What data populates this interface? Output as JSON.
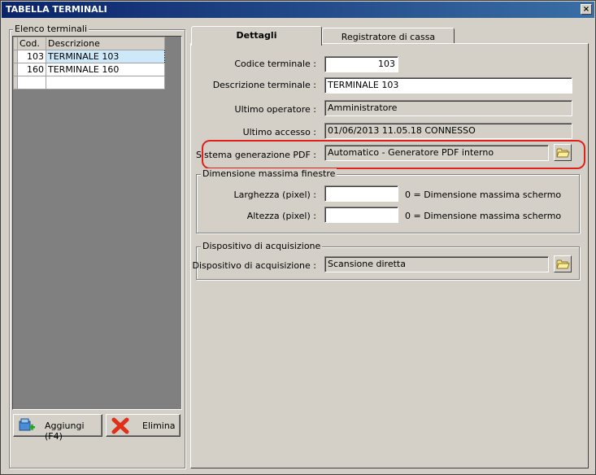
{
  "window": {
    "title": "TABELLA TERMINALI",
    "close_label": "×"
  },
  "left": {
    "group_title": "Elenco terminali",
    "columns": {
      "cod": "Cod.",
      "desc": "Descrizione"
    },
    "rows": [
      {
        "cod": "103",
        "desc": "TERMINALE 103"
      },
      {
        "cod": "160",
        "desc": "TERMINALE 160"
      }
    ],
    "add_button": "Aggiungi (F4)",
    "delete_button": "Elimina"
  },
  "tabs": [
    "Dettagli",
    "Registratore di cassa"
  ],
  "details": {
    "codice_label": "Codice terminale :",
    "codice_value": "103",
    "descrizione_label": "Descrizione terminale :",
    "descrizione_value": "TERMINALE 103",
    "operatore_label": "Ultimo operatore :",
    "operatore_value": "Amministratore",
    "accesso_label": "Ultimo accesso :",
    "accesso_value": "01/06/2013  11.05.18  CONNESSO",
    "pdf_label": "Sistema generazione PDF :",
    "pdf_value": "Automatico - Generatore PDF interno"
  },
  "dimensioni": {
    "group_title": "Dimensione massima finestre",
    "larghezza_label": "Larghezza (pixel) :",
    "larghezza_value": "",
    "altezza_label": "Altezza (pixel) :",
    "altezza_value": "",
    "note": "0 = Dimensione massima schermo"
  },
  "acquisizione": {
    "group_title": "Dispositivo di acquisizione",
    "label": "Dispositivo di acquisizione :",
    "value": "Scansione diretta"
  },
  "colors": {
    "highlight": "#e0201a",
    "titlebar": "#0a246a"
  }
}
